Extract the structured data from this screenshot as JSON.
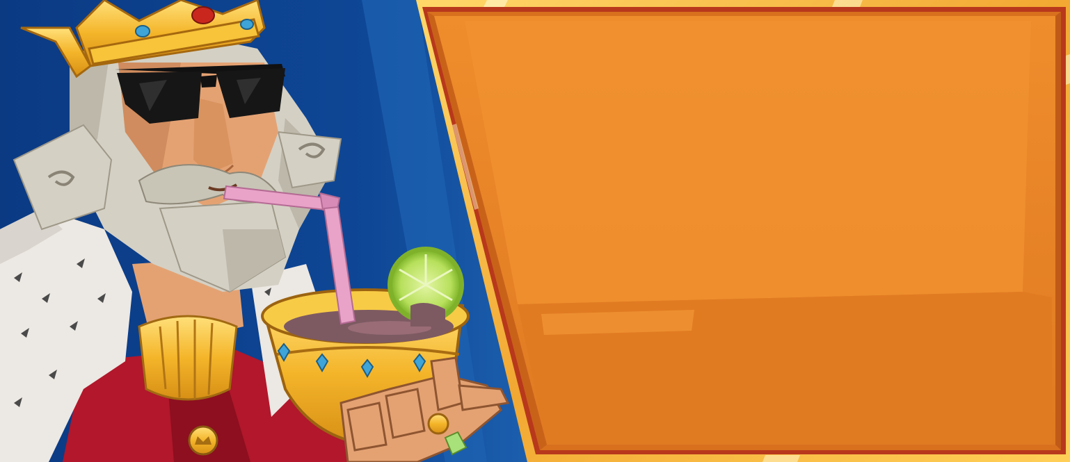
{
  "scene": {
    "type": "game-promo-banner",
    "character": "king-with-sunglasses-drinking-cocktail",
    "panel_text": ""
  },
  "colors": {
    "background_blue": "#0d3f8c",
    "background_blue_light": "#1f63b4",
    "panel_orange": "#ee8a2a",
    "panel_orange_dark": "#dd7420",
    "frame_gold": "#f6c04a",
    "frame_red": "#b6321c",
    "crown_gold": "#f3b52b",
    "robe_red": "#b2172b",
    "fur_white": "#ece8e3",
    "beard_gray": "#d4d0c4",
    "skin": "#e4a273",
    "sunglasses": "#141414",
    "straw_pink": "#e9a3c9",
    "lime_green": "#a9d44a",
    "goblet_gold": "#f4bd2e",
    "gem_blue": "#3fa4d8"
  },
  "icons": [
    "crown-icon",
    "lime-slice-icon",
    "gem-icon"
  ]
}
